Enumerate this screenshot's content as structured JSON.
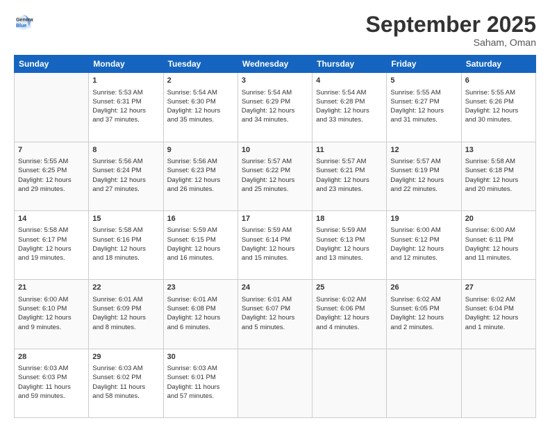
{
  "logo": {
    "line1": "General",
    "line2": "Blue"
  },
  "title": "September 2025",
  "subtitle": "Saham, Oman",
  "days_header": [
    "Sunday",
    "Monday",
    "Tuesday",
    "Wednesday",
    "Thursday",
    "Friday",
    "Saturday"
  ],
  "weeks": [
    [
      {
        "day": "",
        "info": ""
      },
      {
        "day": "1",
        "info": "Sunrise: 5:53 AM\nSunset: 6:31 PM\nDaylight: 12 hours\nand 37 minutes."
      },
      {
        "day": "2",
        "info": "Sunrise: 5:54 AM\nSunset: 6:30 PM\nDaylight: 12 hours\nand 35 minutes."
      },
      {
        "day": "3",
        "info": "Sunrise: 5:54 AM\nSunset: 6:29 PM\nDaylight: 12 hours\nand 34 minutes."
      },
      {
        "day": "4",
        "info": "Sunrise: 5:54 AM\nSunset: 6:28 PM\nDaylight: 12 hours\nand 33 minutes."
      },
      {
        "day": "5",
        "info": "Sunrise: 5:55 AM\nSunset: 6:27 PM\nDaylight: 12 hours\nand 31 minutes."
      },
      {
        "day": "6",
        "info": "Sunrise: 5:55 AM\nSunset: 6:26 PM\nDaylight: 12 hours\nand 30 minutes."
      }
    ],
    [
      {
        "day": "7",
        "info": "Sunrise: 5:55 AM\nSunset: 6:25 PM\nDaylight: 12 hours\nand 29 minutes."
      },
      {
        "day": "8",
        "info": "Sunrise: 5:56 AM\nSunset: 6:24 PM\nDaylight: 12 hours\nand 27 minutes."
      },
      {
        "day": "9",
        "info": "Sunrise: 5:56 AM\nSunset: 6:23 PM\nDaylight: 12 hours\nand 26 minutes."
      },
      {
        "day": "10",
        "info": "Sunrise: 5:57 AM\nSunset: 6:22 PM\nDaylight: 12 hours\nand 25 minutes."
      },
      {
        "day": "11",
        "info": "Sunrise: 5:57 AM\nSunset: 6:21 PM\nDaylight: 12 hours\nand 23 minutes."
      },
      {
        "day": "12",
        "info": "Sunrise: 5:57 AM\nSunset: 6:19 PM\nDaylight: 12 hours\nand 22 minutes."
      },
      {
        "day": "13",
        "info": "Sunrise: 5:58 AM\nSunset: 6:18 PM\nDaylight: 12 hours\nand 20 minutes."
      }
    ],
    [
      {
        "day": "14",
        "info": "Sunrise: 5:58 AM\nSunset: 6:17 PM\nDaylight: 12 hours\nand 19 minutes."
      },
      {
        "day": "15",
        "info": "Sunrise: 5:58 AM\nSunset: 6:16 PM\nDaylight: 12 hours\nand 18 minutes."
      },
      {
        "day": "16",
        "info": "Sunrise: 5:59 AM\nSunset: 6:15 PM\nDaylight: 12 hours\nand 16 minutes."
      },
      {
        "day": "17",
        "info": "Sunrise: 5:59 AM\nSunset: 6:14 PM\nDaylight: 12 hours\nand 15 minutes."
      },
      {
        "day": "18",
        "info": "Sunrise: 5:59 AM\nSunset: 6:13 PM\nDaylight: 12 hours\nand 13 minutes."
      },
      {
        "day": "19",
        "info": "Sunrise: 6:00 AM\nSunset: 6:12 PM\nDaylight: 12 hours\nand 12 minutes."
      },
      {
        "day": "20",
        "info": "Sunrise: 6:00 AM\nSunset: 6:11 PM\nDaylight: 12 hours\nand 11 minutes."
      }
    ],
    [
      {
        "day": "21",
        "info": "Sunrise: 6:00 AM\nSunset: 6:10 PM\nDaylight: 12 hours\nand 9 minutes."
      },
      {
        "day": "22",
        "info": "Sunrise: 6:01 AM\nSunset: 6:09 PM\nDaylight: 12 hours\nand 8 minutes."
      },
      {
        "day": "23",
        "info": "Sunrise: 6:01 AM\nSunset: 6:08 PM\nDaylight: 12 hours\nand 6 minutes."
      },
      {
        "day": "24",
        "info": "Sunrise: 6:01 AM\nSunset: 6:07 PM\nDaylight: 12 hours\nand 5 minutes."
      },
      {
        "day": "25",
        "info": "Sunrise: 6:02 AM\nSunset: 6:06 PM\nDaylight: 12 hours\nand 4 minutes."
      },
      {
        "day": "26",
        "info": "Sunrise: 6:02 AM\nSunset: 6:05 PM\nDaylight: 12 hours\nand 2 minutes."
      },
      {
        "day": "27",
        "info": "Sunrise: 6:02 AM\nSunset: 6:04 PM\nDaylight: 12 hours\nand 1 minute."
      }
    ],
    [
      {
        "day": "28",
        "info": "Sunrise: 6:03 AM\nSunset: 6:03 PM\nDaylight: 11 hours\nand 59 minutes."
      },
      {
        "day": "29",
        "info": "Sunrise: 6:03 AM\nSunset: 6:02 PM\nDaylight: 11 hours\nand 58 minutes."
      },
      {
        "day": "30",
        "info": "Sunrise: 6:03 AM\nSunset: 6:01 PM\nDaylight: 11 hours\nand 57 minutes."
      },
      {
        "day": "",
        "info": ""
      },
      {
        "day": "",
        "info": ""
      },
      {
        "day": "",
        "info": ""
      },
      {
        "day": "",
        "info": ""
      }
    ]
  ]
}
